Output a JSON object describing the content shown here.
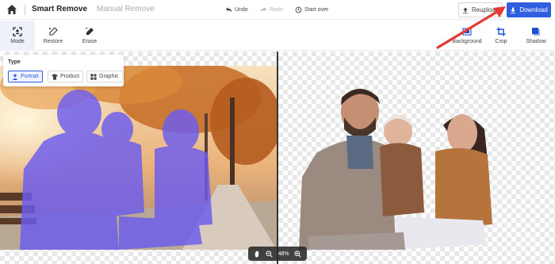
{
  "header": {
    "tabs": [
      {
        "label": "Smart Remove",
        "active": true
      },
      {
        "label": "Manual Remove",
        "active": false
      }
    ],
    "undo_label": "Undo",
    "redo_label": "Redo",
    "start_over_label": "Start over",
    "reupload_label": "Reupload",
    "download_label": "Download",
    "icons": {
      "home": "home-icon",
      "undo": "undo-icon",
      "redo": "redo-icon",
      "start_over": "history-icon",
      "reupload": "upload-icon",
      "download": "download-icon"
    }
  },
  "toolbar": {
    "left_tools": [
      {
        "label": "Mode",
        "icon": "focus-frame-icon",
        "active": true
      },
      {
        "label": "Restore",
        "icon": "restore-brush-icon"
      },
      {
        "label": "Erase",
        "icon": "erase-brush-icon"
      }
    ],
    "right_tools": [
      {
        "label": "Background",
        "icon": "background-icon"
      },
      {
        "label": "Crop",
        "icon": "crop-icon"
      },
      {
        "label": "Shadow",
        "icon": "shadow-icon"
      }
    ]
  },
  "type_panel": {
    "title": "Type",
    "options": [
      {
        "label": "Portrait",
        "icon": "person-icon",
        "selected": true
      },
      {
        "label": "Product",
        "icon": "shirt-icon",
        "selected": false
      },
      {
        "label": "Graphic",
        "icon": "shapes-icon",
        "selected": false
      }
    ]
  },
  "zoom": {
    "level": "48%",
    "icons": [
      "hand-icon",
      "zoom-out-icon",
      "zoom-in-icon"
    ]
  },
  "colors": {
    "accent": "#2f5ee0",
    "annotation_arrow": "#e53935",
    "mask_tint": "#6c5cf0"
  }
}
